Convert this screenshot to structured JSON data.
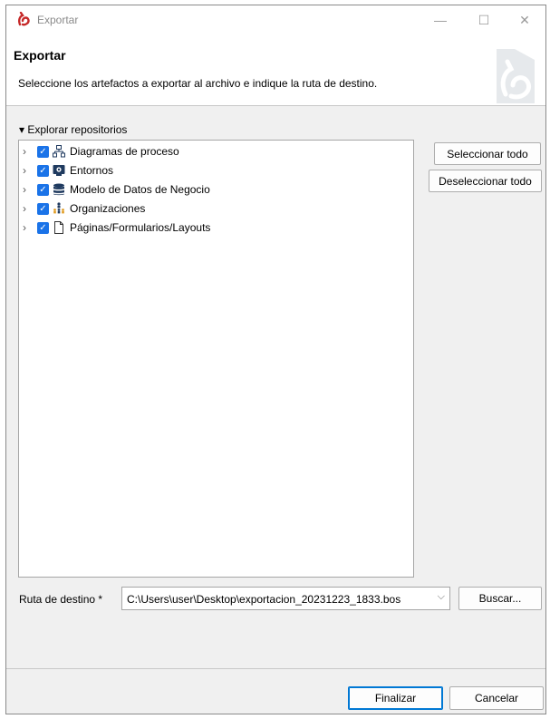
{
  "window": {
    "title": "Exportar",
    "logo_icon": "bonita-logo-icon",
    "minimize": "—",
    "maximize": "☐",
    "close": "✕"
  },
  "header": {
    "title": "Exportar",
    "description": "Seleccione los artefactos a exportar al archivo e indique la ruta de destino."
  },
  "repositories": {
    "section_label": "Explorar repositorios",
    "expanded_arrow": "▾",
    "items": [
      {
        "label": "Diagramas de proceso",
        "checked": true,
        "icon": "process-diagram-icon"
      },
      {
        "label": "Entornos",
        "checked": true,
        "icon": "environment-icon"
      },
      {
        "label": "Modelo de Datos de Negocio",
        "checked": true,
        "icon": "database-icon"
      },
      {
        "label": "Organizaciones",
        "checked": true,
        "icon": "organization-icon"
      },
      {
        "label": "Páginas/Formularios/Layouts",
        "checked": true,
        "icon": "page-icon"
      }
    ],
    "expander": "›",
    "check_mark": "✓"
  },
  "actions": {
    "select_all": "Seleccionar todo",
    "deselect_all": "Deseleccionar todo",
    "browse": "Buscar...",
    "finish": "Finalizar",
    "cancel": "Cancelar"
  },
  "destination": {
    "label": "Ruta de destino *",
    "value": "C:\\Users\\user\\Desktop\\exportacion_20231223_1833.bos",
    "dropdown_arrow": "⌵"
  },
  "colors": {
    "accent": "#1a73e8",
    "primary_border": "#0078d4",
    "logo": "#c62828"
  }
}
